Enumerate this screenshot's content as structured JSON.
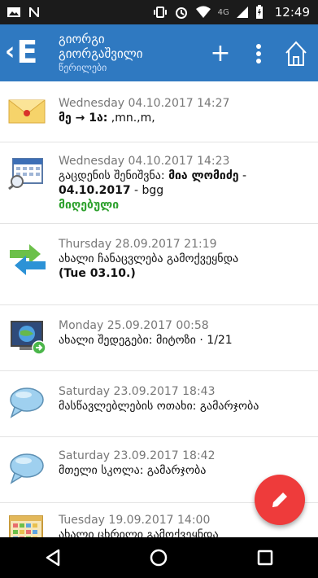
{
  "status_bar": {
    "time": "12:49",
    "network": "4G",
    "icons": [
      "image-icon",
      "n-icon",
      "vibrate-icon",
      "alarm-icon",
      "wifi-icon",
      "signal-icon",
      "battery-icon"
    ]
  },
  "app_bar": {
    "title_line1": "გიორგი",
    "title_line2": "გიორგაშვილი",
    "subtitle": "წერილები",
    "logo_letter": "E",
    "back_symbol": "‹",
    "plus_symbol": "+",
    "background": "#2f79c1"
  },
  "messages": [
    {
      "icon": "envelope-icon",
      "date": "Wednesday 04.10.2017 14:27",
      "line_bold": "მე → 1ა:",
      "line_rest": " ,mn.,m,"
    },
    {
      "icon": "calendar-icon",
      "date": "Wednesday 04.10.2017 14:23",
      "prefix": "გაცდენის შენიშვნა: ",
      "name_bold": "მია ლომიძე",
      "sep": " -",
      "date_bold": "04.10.2017",
      "suffix": " - bgg",
      "status": "მიღებული"
    },
    {
      "icon": "exchange-arrows-icon",
      "date": "Thursday 28.09.2017 21:19",
      "line": "ახალი ჩანაცვლება გამოქვეყნდა",
      "extra_bold": "(Tue 03.10.)"
    },
    {
      "icon": "grades-monitor-icon",
      "date": "Monday 25.09.2017 00:58",
      "line": "ახალი შედეგები: მიტოზი · 1/21"
    },
    {
      "icon": "speech-bubble-icon",
      "date": "Saturday 23.09.2017 18:43",
      "line": "მასწავლებლების ოთახი: გამარჯობა"
    },
    {
      "icon": "speech-bubble-icon",
      "date": "Saturday 23.09.2017 18:42",
      "line": "მთელი სკოლა: გამარჯობა"
    },
    {
      "icon": "timetable-icon",
      "date": "Tuesday 19.09.2017 14:00",
      "line": "ახალი ცხრილი გამოქვეყნდა"
    }
  ],
  "fab": {
    "icon": "pencil-icon",
    "color": "#ee3b3b"
  },
  "nav_bar": {
    "buttons": [
      "back-triangle-icon",
      "home-circle-icon",
      "recents-square-icon"
    ]
  }
}
